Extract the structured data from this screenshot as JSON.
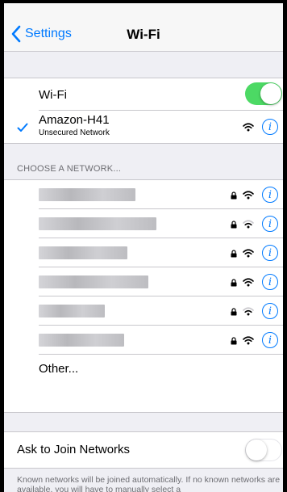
{
  "nav": {
    "back_label": "Settings",
    "title": "Wi-Fi"
  },
  "wifi_row": {
    "label": "Wi-Fi",
    "toggle_on": true
  },
  "connected": {
    "name": "Amazon-H41",
    "status": "Unsecured Network"
  },
  "networks_header": "CHOOSE A NETWORK...",
  "networks": [
    {
      "name": "",
      "secured": true
    },
    {
      "name": "",
      "secured": true
    },
    {
      "name": "",
      "secured": true
    },
    {
      "name": "",
      "secured": true
    },
    {
      "name": "",
      "secured": true
    },
    {
      "name": "",
      "secured": true
    }
  ],
  "other_label": "Other...",
  "ask_join": {
    "label": "Ask to Join Networks",
    "toggle_on": false
  },
  "footer": "Known networks will be joined automatically. If no known networks are available, you will have to manually select a",
  "info_glyph": "i",
  "colors": {
    "accent": "#007aff",
    "toggle_on": "#4cd964"
  }
}
